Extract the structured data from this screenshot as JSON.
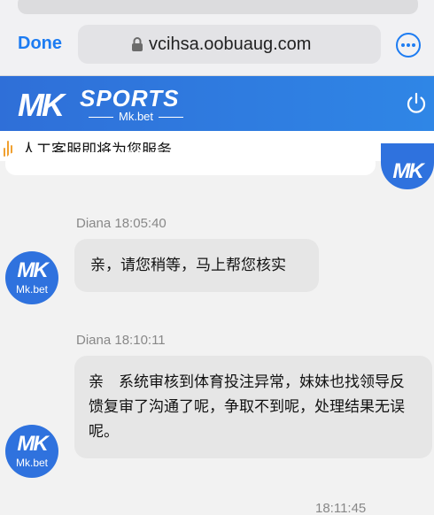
{
  "browser": {
    "done_label": "Done",
    "url": "vcihsa.oobuaug.com",
    "lock_icon": "lock-icon",
    "more_icon": "more-icon"
  },
  "brand": {
    "logo_mark": "MK",
    "logo_word": "SPORTS",
    "logo_sub": "Mk.bet",
    "power_icon": "power-icon",
    "color": "#2f78e0"
  },
  "notice": {
    "icon": "voice-wave-icon",
    "text": "人工客服即将为您服务"
  },
  "chat": {
    "messages": [
      {
        "sender": "Diana",
        "time": "18:05:40",
        "text": "亲，请您稍等，马上帮您核实",
        "avatar_mark": "MK",
        "avatar_sub": "Mk.bet"
      },
      {
        "sender": "Diana",
        "time": "18:10:11",
        "text": "亲　系统审核到体育投注异常，妹妹也找领导反馈复审了沟通了呢，争取不到呢，处理结果无误呢。",
        "avatar_mark": "MK",
        "avatar_sub": "Mk.bet"
      }
    ],
    "self_time": "18:11:45",
    "self_avatar_mark": "MK"
  }
}
